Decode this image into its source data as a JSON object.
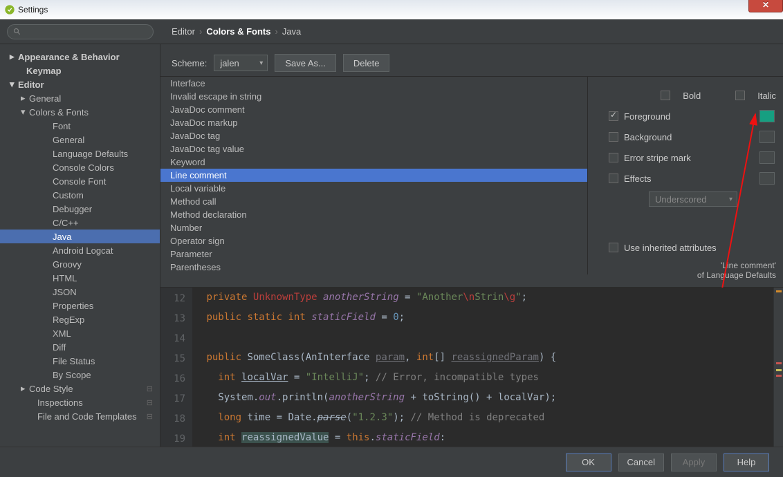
{
  "window_title": "Settings",
  "search_placeholder": "",
  "breadcrumb": {
    "a": "Editor",
    "b": "Colors & Fonts",
    "c": "Java"
  },
  "sidebar": [
    {
      "label": "Appearance & Behavior",
      "bold": true,
      "arrow": "▸",
      "ind": 0
    },
    {
      "label": "Keymap",
      "bold": true,
      "ind": 0,
      "pad": true
    },
    {
      "label": "Editor",
      "bold": true,
      "arrow": "▾",
      "ind": 0
    },
    {
      "label": "General",
      "arrow": "▸",
      "ind": 1
    },
    {
      "label": "Colors & Fonts",
      "arrow": "▾",
      "ind": 1
    },
    {
      "label": "Font",
      "ind": 3
    },
    {
      "label": "General",
      "ind": 3
    },
    {
      "label": "Language Defaults",
      "ind": 3
    },
    {
      "label": "Console Colors",
      "ind": 3
    },
    {
      "label": "Console Font",
      "ind": 3
    },
    {
      "label": "Custom",
      "ind": 3
    },
    {
      "label": "Debugger",
      "ind": 3
    },
    {
      "label": "C/C++",
      "ind": 3
    },
    {
      "label": "Java",
      "ind": 3,
      "sel": true
    },
    {
      "label": "Android Logcat",
      "ind": 3
    },
    {
      "label": "Groovy",
      "ind": 3
    },
    {
      "label": "HTML",
      "ind": 3
    },
    {
      "label": "JSON",
      "ind": 3
    },
    {
      "label": "Properties",
      "ind": 3
    },
    {
      "label": "RegExp",
      "ind": 3
    },
    {
      "label": "XML",
      "ind": 3
    },
    {
      "label": "Diff",
      "ind": 3
    },
    {
      "label": "File Status",
      "ind": 3
    },
    {
      "label": "By Scope",
      "ind": 3
    },
    {
      "label": "Code Style",
      "arrow": "▸",
      "ind": 1,
      "scope": true
    },
    {
      "label": "Inspections",
      "ind": 1,
      "pad": true,
      "scope": true
    },
    {
      "label": "File and Code Templates",
      "ind": 1,
      "pad": true,
      "scope": true
    }
  ],
  "scheme_label": "Scheme:",
  "scheme_name": "jalen",
  "save_as": "Save As...",
  "delete": "Delete",
  "attrs": [
    "Interface",
    "Invalid escape in string",
    "JavaDoc comment",
    "JavaDoc markup",
    "JavaDoc tag",
    "JavaDoc tag value",
    "Keyword",
    "Line comment",
    "Local variable",
    "Method call",
    "Method declaration",
    "Number",
    "Operator sign",
    "Parameter",
    "Parentheses"
  ],
  "attr_selected": "Line comment",
  "props": {
    "bold": "Bold",
    "italic": "Italic",
    "foreground": "Foreground",
    "background": "Background",
    "errstripe": "Error stripe mark",
    "effects": "Effects",
    "underscored": "Underscored",
    "inherit": "Use inherited attributes"
  },
  "inherit_note": {
    "a": "'Line comment'",
    "b": "of ",
    "c": "Language Defaults"
  },
  "code": {
    "lines": [
      12,
      13,
      14,
      15,
      16,
      17,
      18,
      19
    ]
  },
  "footer": {
    "ok": "OK",
    "cancel": "Cancel",
    "apply": "Apply",
    "help": "Help"
  }
}
